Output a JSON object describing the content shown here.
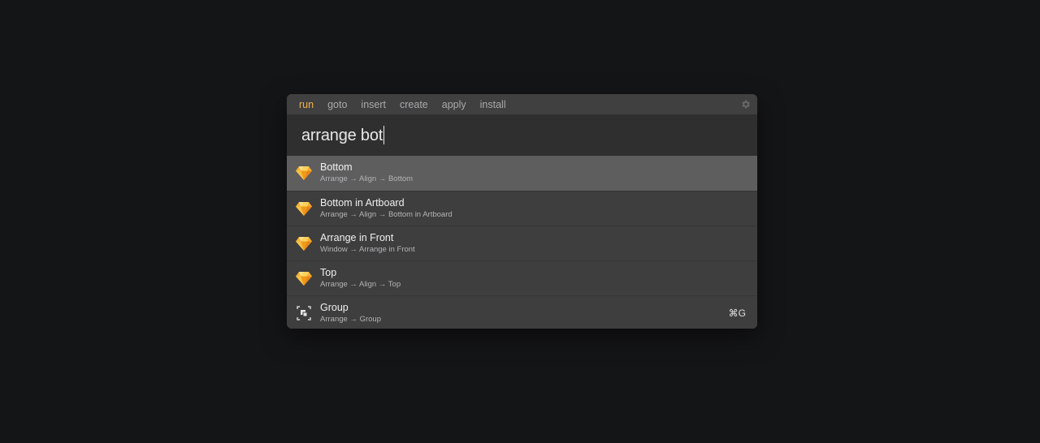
{
  "tabs": [
    {
      "label": "run",
      "active": true
    },
    {
      "label": "goto",
      "active": false
    },
    {
      "label": "insert",
      "active": false
    },
    {
      "label": "create",
      "active": false
    },
    {
      "label": "apply",
      "active": false
    },
    {
      "label": "install",
      "active": false
    }
  ],
  "search": {
    "value": "arrange bot"
  },
  "results": [
    {
      "title": "Bottom",
      "path": "Arrange → Align → Bottom",
      "icon": "sketch-diamond-icon",
      "selected": true,
      "shortcut": ""
    },
    {
      "title": "Bottom in Artboard",
      "path": "Arrange → Align → Bottom in Artboard",
      "icon": "sketch-diamond-icon",
      "selected": false,
      "shortcut": ""
    },
    {
      "title": "Arrange in Front",
      "path": "Window → Arrange in Front",
      "icon": "sketch-diamond-icon",
      "selected": false,
      "shortcut": ""
    },
    {
      "title": "Top",
      "path": "Arrange → Align → Top",
      "icon": "sketch-diamond-icon",
      "selected": false,
      "shortcut": ""
    },
    {
      "title": "Group",
      "path": "Arrange → Group",
      "icon": "group-icon",
      "selected": false,
      "shortcut": "⌘G"
    }
  ],
  "colors": {
    "accent": "#f2b347",
    "background": "#141517",
    "selected_row": "#5e5e5f"
  }
}
